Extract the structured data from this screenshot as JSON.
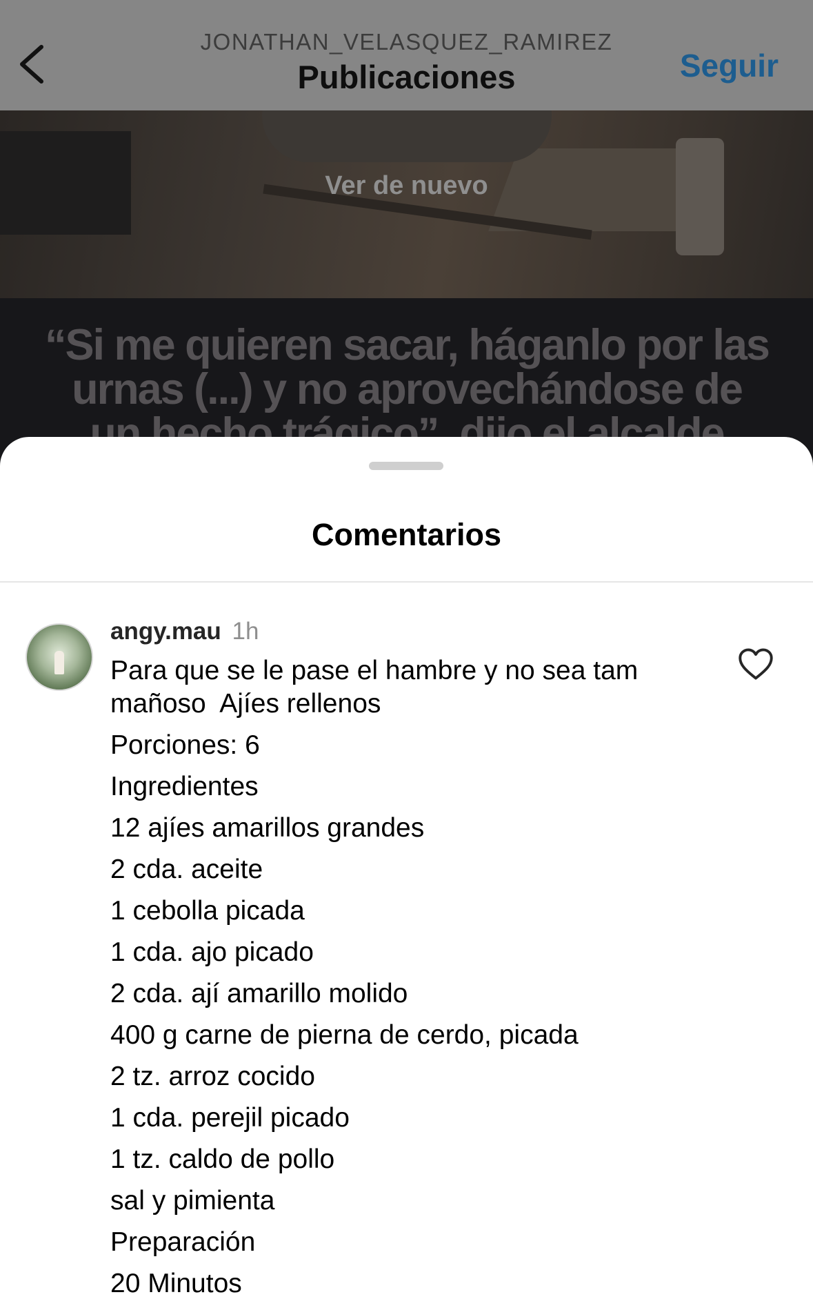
{
  "header": {
    "username": "JONATHAN_VELASQUEZ_RAMIREZ",
    "title": "Publicaciones",
    "follow_label": "Seguir",
    "back_icon": "chevron-left-icon"
  },
  "post": {
    "replay_label": "Ver de nuevo",
    "quote_text": "“Si me quieren sacar, háganlo por las urnas (...) y no aprovechándose de un hecho trágico”, dijo el alcalde"
  },
  "comments_sheet": {
    "title": "Comentarios",
    "comment": {
      "username": "angy.mau",
      "time": "1h",
      "like_icon": "heart-outline-icon",
      "lines": [
        "Para que se le pase el hambre y no sea tam mañoso  Ajíes rellenos",
        "Porciones: 6",
        "Ingredientes",
        "12 ajíes amarillos grandes",
        "2 cda. aceite",
        "1 cebolla picada",
        "1 cda. ajo picado",
        "2 cda. ají amarillo molido",
        "400 g carne de pierna de cerdo, picada",
        "2 tz. arroz cocido",
        "1 cda. perejil picado",
        "1 tz. caldo de pollo",
        "sal y pimienta",
        "Preparación",
        "20 Minutos"
      ]
    }
  },
  "colors": {
    "follow": "#1d5d8f",
    "overlay_header": "#868686",
    "sheet_background": "#ffffff"
  }
}
